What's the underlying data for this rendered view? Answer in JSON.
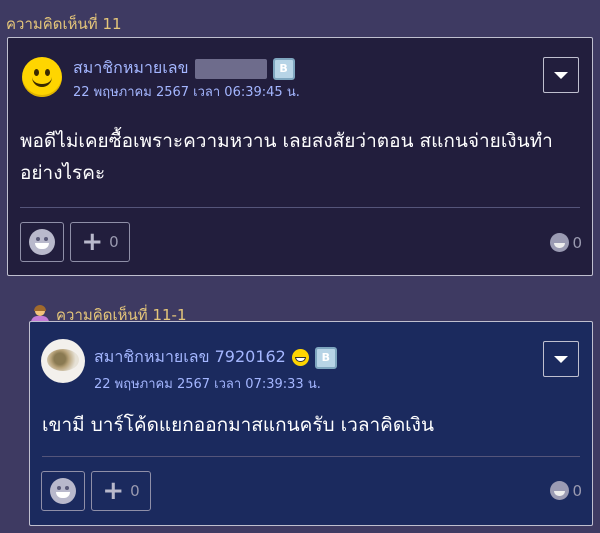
{
  "comment": {
    "label": "ความคิดเห็นที่ 11",
    "username": "สมาชิกหมายเลข",
    "badge": "B",
    "date": "22 พฤษภาคม 2567 เวลา 06:39:45 น.",
    "body": "พอดีไม่เคยซื้อเพราะความหวาน  เลยสงสัยว่าตอน สแกนจ่ายเงินทำอย่างไรคะ",
    "plus_count": "0",
    "emotion_count": "0",
    "avatar_icon": "smiley-avatar-icon"
  },
  "reply": {
    "label": "ความคิดเห็นที่ 11-1",
    "username": "สมาชิกหมายเลข 7920162",
    "badge": "B",
    "date": "22 พฤษภาคม 2567 เวลา 07:39:33 น.",
    "body": "เขามี บาร์โค้ดแยกออกมาสแกนครับ เวลาคิดเงิน",
    "plus_count": "0",
    "emotion_count": "0",
    "avatar_icon": "food-photo-avatar"
  },
  "colors": {
    "background": "#3e3a62",
    "comment_card": "#221e3d",
    "reply_card": "#1b2a5e",
    "label": "#e5c67a",
    "username": "#a4b6ff"
  }
}
